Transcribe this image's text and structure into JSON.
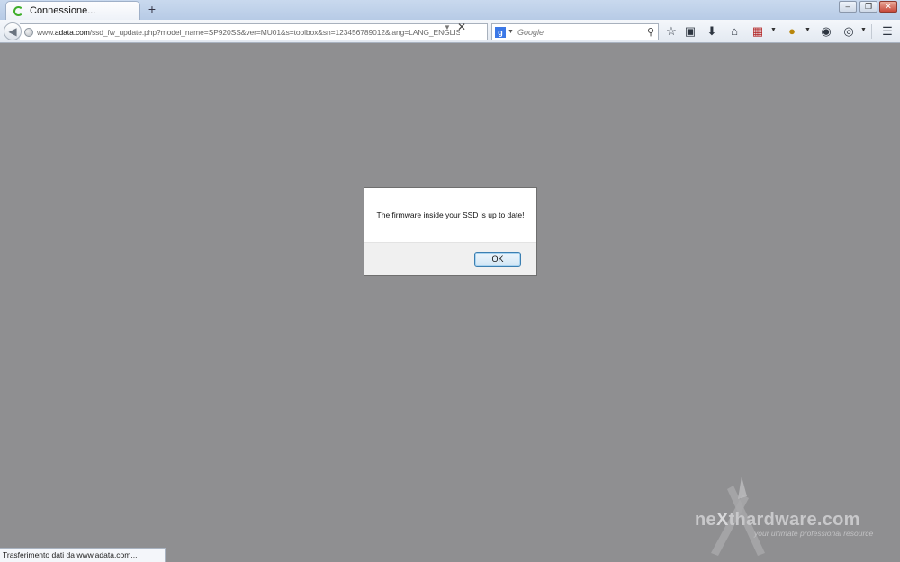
{
  "tab": {
    "title": "Connessione...",
    "new_tab": "+"
  },
  "window_controls": {
    "minimize": "–",
    "maximize": "❐",
    "close": "✕"
  },
  "address_bar": {
    "url_prefix": "www.",
    "url_domain": "adata.com",
    "url_path": "/ssd_fw_update.php?model_name=SP920SS&ver=MU01&s=toolbox&sn=123456789012&lang=LANG_ENGLISH",
    "stop": "✕"
  },
  "search_bar": {
    "engine": "g",
    "placeholder": "Google"
  },
  "toolbar_icons": [
    "bookmark-star-icon",
    "reading-list-icon",
    "download-icon",
    "home-icon",
    "pdf-addon-icon",
    "addon-icon",
    "privacy-addon-icon",
    "screen-addon-icon",
    "menu-icon"
  ],
  "dialog": {
    "message": "The firmware inside your SSD is up to date!",
    "ok_label": "OK"
  },
  "watermark": {
    "brand_pre": "ne",
    "brand_x": "X",
    "brand_post": "thardware.com",
    "tagline": "your ultimate professional resource"
  },
  "status_bar": {
    "text": "Trasferimento dati da www.adata.com..."
  },
  "colors": {
    "page_background": "#8f8f91",
    "dialog_button_border": "#3c7fb1",
    "loading_spinner": "#3fae2a"
  }
}
